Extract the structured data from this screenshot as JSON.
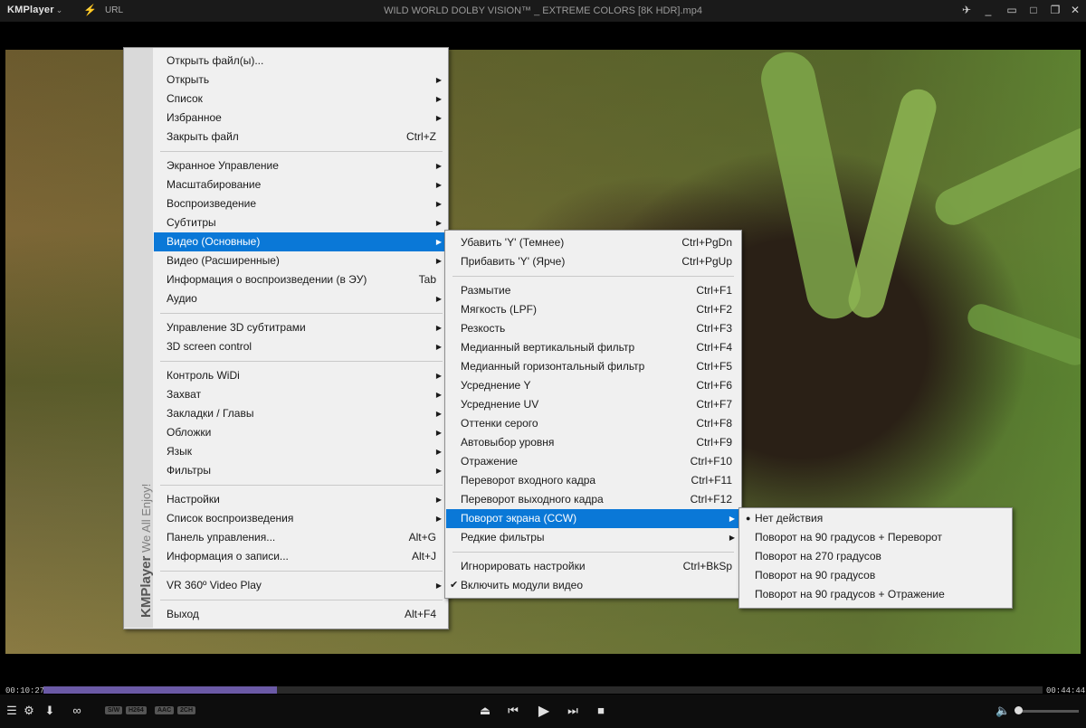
{
  "titlebar": {
    "app_name": "KMPlayer",
    "url_label": "URL",
    "file_title": "WILD WORLD DOLBY VISION™ _ EXTREME COLORS [8K HDR].mp4",
    "icons": [
      "pin-icon",
      "minimize-icon",
      "maximize-icon",
      "restore-icon",
      "close-icon"
    ]
  },
  "main_menu": {
    "side_brand": "KMPlayer",
    "side_slogan": "We All Enjoy!",
    "items": [
      {
        "label": "Открыть файл(ы)...",
        "shortcut": "",
        "submenu": false
      },
      {
        "label": "Открыть",
        "shortcut": "",
        "submenu": true
      },
      {
        "label": "Список",
        "shortcut": "",
        "submenu": true
      },
      {
        "label": "Избранное",
        "shortcut": "",
        "submenu": true
      },
      {
        "label": "Закрыть файл",
        "shortcut": "Ctrl+Z",
        "submenu": false
      },
      {
        "label": "Экранное Управление",
        "shortcut": "",
        "submenu": true
      },
      {
        "label": "Масштабирование",
        "shortcut": "",
        "submenu": true
      },
      {
        "label": "Воспроизведение",
        "shortcut": "",
        "submenu": true
      },
      {
        "label": "Субтитры",
        "shortcut": "",
        "submenu": true
      },
      {
        "label": "Видео (Основные)",
        "shortcut": "",
        "submenu": true,
        "highlighted": true
      },
      {
        "label": "Видео (Расширенные)",
        "shortcut": "",
        "submenu": true
      },
      {
        "label": "Информация о воспроизведении (в ЭУ)",
        "shortcut": "Tab",
        "submenu": false
      },
      {
        "label": "Аудио",
        "shortcut": "",
        "submenu": true
      },
      {
        "label": "Управление 3D субтитрами",
        "shortcut": "",
        "submenu": true
      },
      {
        "label": "3D screen control",
        "shortcut": "",
        "submenu": true
      },
      {
        "label": "Контроль WiDi",
        "shortcut": "",
        "submenu": true
      },
      {
        "label": "Захват",
        "shortcut": "",
        "submenu": true
      },
      {
        "label": "Закладки / Главы",
        "shortcut": "",
        "submenu": true
      },
      {
        "label": "Обложки",
        "shortcut": "",
        "submenu": true
      },
      {
        "label": "Язык",
        "shortcut": "",
        "submenu": true
      },
      {
        "label": "Фильтры",
        "shortcut": "",
        "submenu": true
      },
      {
        "label": "Настройки",
        "shortcut": "",
        "submenu": true
      },
      {
        "label": "Список воспроизведения",
        "shortcut": "",
        "submenu": true
      },
      {
        "label": "Панель управления...",
        "shortcut": "Alt+G",
        "submenu": false
      },
      {
        "label": "Информация о записи...",
        "shortcut": "Alt+J",
        "submenu": false
      },
      {
        "label": "VR 360º Video Play",
        "shortcut": "",
        "submenu": true
      },
      {
        "label": "Выход",
        "shortcut": "Alt+F4",
        "submenu": false
      }
    ]
  },
  "video_menu": {
    "items": [
      {
        "label": "Убавить 'Y' (Темнее)",
        "shortcut": "Ctrl+PgDn",
        "submenu": false
      },
      {
        "label": "Прибавить 'Y' (Ярче)",
        "shortcut": "Ctrl+PgUp",
        "submenu": false
      },
      {
        "label": "Размытие",
        "shortcut": "Ctrl+F1",
        "submenu": false
      },
      {
        "label": "Мягкость (LPF)",
        "shortcut": "Ctrl+F2",
        "submenu": false
      },
      {
        "label": "Резкость",
        "shortcut": "Ctrl+F3",
        "submenu": false
      },
      {
        "label": "Медианный вертикальный фильтр",
        "shortcut": "Ctrl+F4",
        "submenu": false
      },
      {
        "label": "Медианный горизонтальный фильтр",
        "shortcut": "Ctrl+F5",
        "submenu": false
      },
      {
        "label": "Усреднение Y",
        "shortcut": "Ctrl+F6",
        "submenu": false
      },
      {
        "label": "Усреднение UV",
        "shortcut": "Ctrl+F7",
        "submenu": false
      },
      {
        "label": "Оттенки серого",
        "shortcut": "Ctrl+F8",
        "submenu": false
      },
      {
        "label": "Автовыбор уровня",
        "shortcut": "Ctrl+F9",
        "submenu": false
      },
      {
        "label": "Отражение",
        "shortcut": "Ctrl+F10",
        "submenu": false
      },
      {
        "label": "Переворот входного кадра",
        "shortcut": "Ctrl+F11",
        "submenu": false
      },
      {
        "label": "Переворот выходного кадра",
        "shortcut": "Ctrl+F12",
        "submenu": false
      },
      {
        "label": "Поворот экрана (CCW)",
        "shortcut": "",
        "submenu": true,
        "highlighted": true
      },
      {
        "label": "Редкие фильтры",
        "shortcut": "",
        "submenu": true
      },
      {
        "label": "Игнорировать настройки",
        "shortcut": "Ctrl+BkSp",
        "submenu": false
      },
      {
        "label": "Включить модули видео",
        "shortcut": "",
        "submenu": false,
        "checked": true
      }
    ]
  },
  "rotate_menu": {
    "items": [
      {
        "label": "Нет действия",
        "selected": true
      },
      {
        "label": "Поворот на 90 градусов + Переворот",
        "selected": false
      },
      {
        "label": "Поворот на 270 градусов",
        "selected": false
      },
      {
        "label": "Поворот на 90 градусов",
        "selected": false
      },
      {
        "label": "Поворот на 90 градусов + Отражение",
        "selected": false
      }
    ]
  },
  "playback": {
    "current_time": "00:10:27",
    "total_time": "00:44:44",
    "progress": 0.2337,
    "badges": [
      "S/W",
      "H264",
      "AAC",
      "2CH"
    ],
    "volume": 0.0
  },
  "colors": {
    "highlight": "#0a78d7",
    "seek_fill": "#6b5aa6",
    "menu_bg": "#f0f0f0"
  }
}
